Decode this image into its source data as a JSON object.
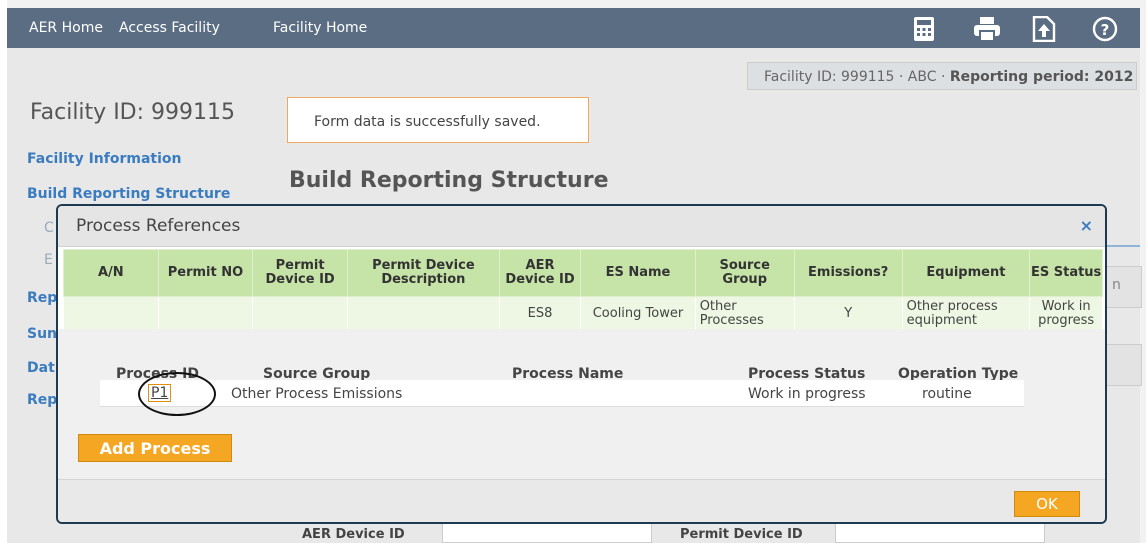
{
  "topbar": {
    "nav": [
      "AER Home",
      "Access Facility",
      "Facility Home"
    ],
    "icons": [
      "calculator-icon",
      "printer-icon",
      "upload-icon",
      "help-icon"
    ],
    "bg_color": "#5b6d83"
  },
  "facility_bar": {
    "prefix": "Facility ID: 999115 · ABC · ",
    "period": "Reporting period: 2012"
  },
  "page": {
    "facility_title": "Facility ID: 999115",
    "toast": "Form data is successfully saved.",
    "title": "Build Reporting Structure"
  },
  "sidebar": {
    "items": [
      {
        "label": "Facility Information"
      },
      {
        "label": "Build Reporting Structure"
      },
      {
        "label": "C"
      },
      {
        "label": "E"
      },
      {
        "label": "Rep"
      },
      {
        "label": "Sun"
      },
      {
        "label": "Dat"
      },
      {
        "label": "Rep"
      }
    ]
  },
  "background_form": {
    "right_letter": "n",
    "aer_device_label": "AER Device ID",
    "permit_device_label": "Permit Device ID"
  },
  "modal": {
    "title": "Process References",
    "close_glyph": "×",
    "table": {
      "headers": [
        "A/N",
        "Permit NO",
        "Permit Device ID",
        "Permit Device Description",
        "AER Device ID",
        "ES Name",
        "Source Group",
        "Emissions?",
        "Equipment",
        "ES Status"
      ],
      "row": [
        "",
        "",
        "",
        "",
        "ES8",
        "Cooling Tower",
        "Other Processes",
        "Y",
        "Other process equipment",
        "Work in progress"
      ]
    },
    "process": {
      "headers": [
        "Process ID",
        "Source Group",
        "Process Name",
        "Process Status",
        "Operation Type"
      ],
      "rows": [
        {
          "id": "P1",
          "source_group": "Other Process Emissions",
          "name": "",
          "status": "Work in progress",
          "operation": "routine"
        }
      ]
    },
    "add_process_label": "Add Process",
    "ok_label": "OK"
  },
  "colors": {
    "accent_orange": "#f5a623",
    "header_green": "#c6e3a8",
    "row_green": "#eef6e4",
    "link_blue": "#3a7cbf"
  }
}
